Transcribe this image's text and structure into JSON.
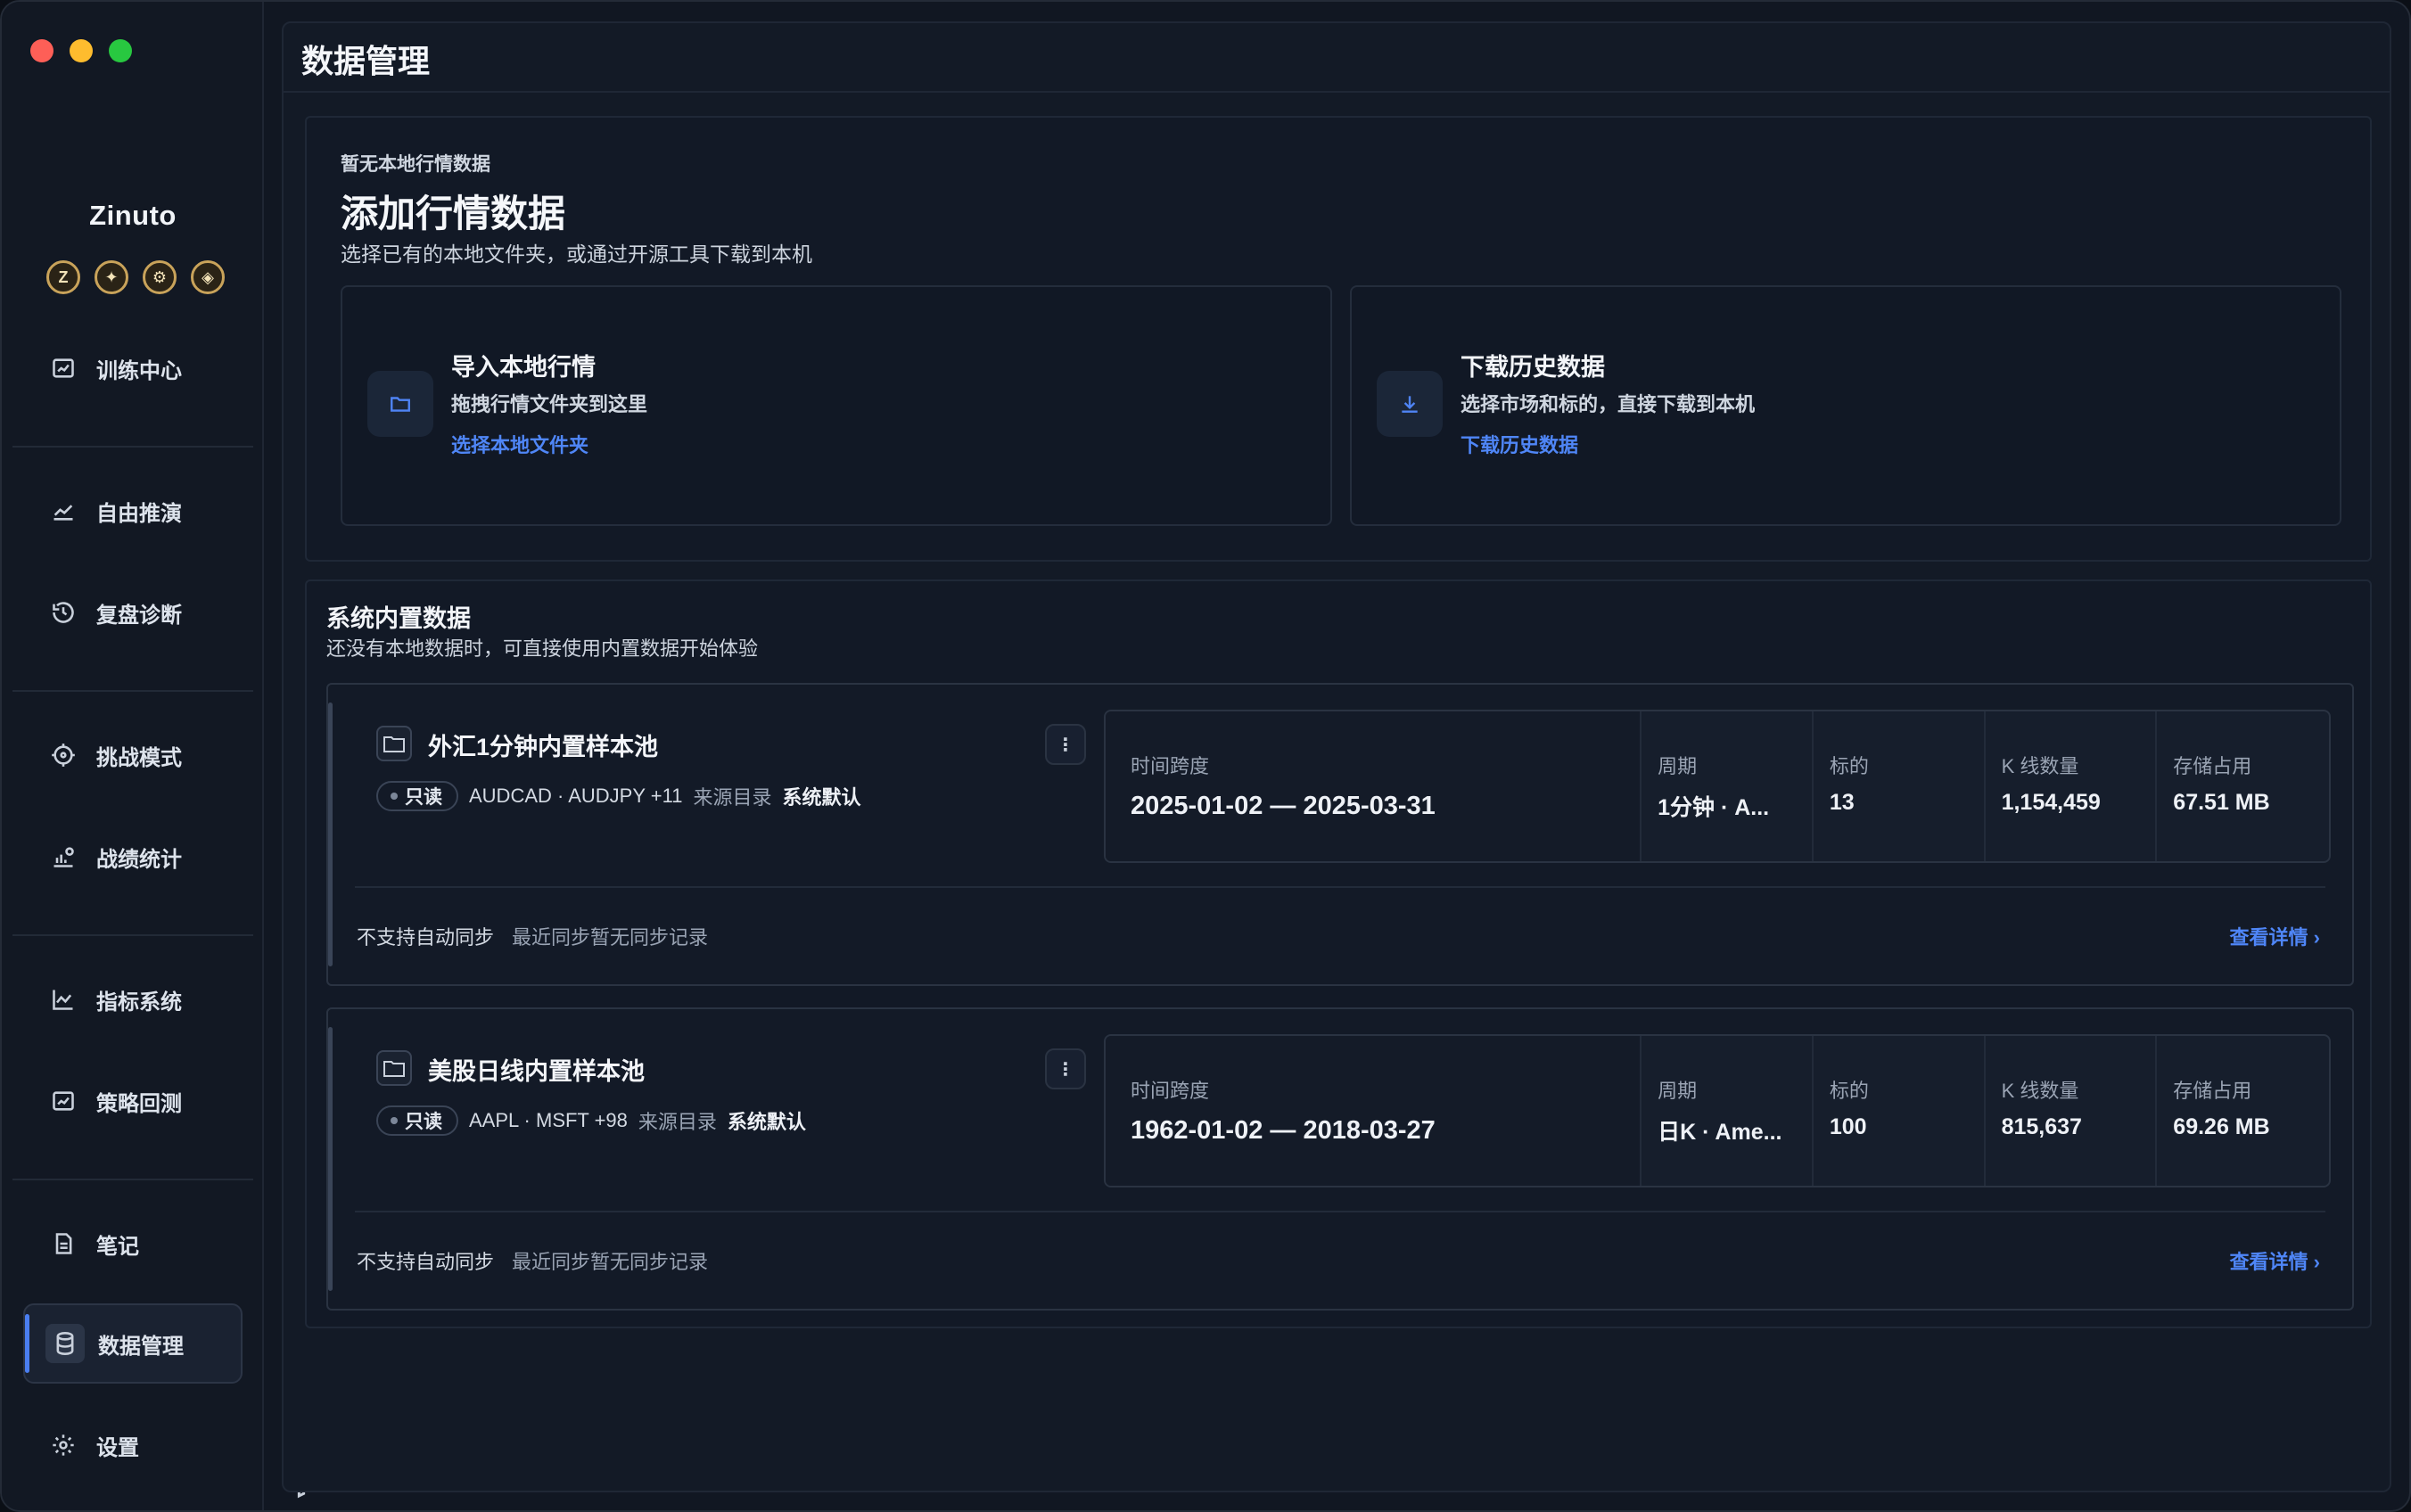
{
  "app": {
    "brand": "Zinuto",
    "coins": [
      "Z",
      "✦",
      "⚙",
      "◈"
    ]
  },
  "sidebar": {
    "items": [
      {
        "label": "训练中心",
        "icon": "image-chart-icon"
      },
      {
        "label": "自由推演",
        "icon": "trend-line-icon"
      },
      {
        "label": "复盘诊断",
        "icon": "history-icon"
      },
      {
        "label": "挑战模式",
        "icon": "target-icon"
      },
      {
        "label": "战绩统计",
        "icon": "bar-user-icon"
      },
      {
        "label": "指标系统",
        "icon": "line-chart-icon"
      },
      {
        "label": "策略回测",
        "icon": "image-chart-icon"
      },
      {
        "label": "笔记",
        "icon": "document-icon"
      },
      {
        "label": "数据管理",
        "icon": "database-icon",
        "active": true
      },
      {
        "label": "设置",
        "icon": "gear-icon"
      }
    ]
  },
  "page": {
    "title": "数据管理"
  },
  "empty": {
    "eyebrow": "暂无本地行情数据",
    "headline": "添加行情数据",
    "subtitle": "选择已有的本地文件夹，或通过开源工具下载到本机",
    "import": {
      "title": "导入本地行情",
      "desc": "拖拽行情文件夹到这里",
      "link": "选择本地文件夹"
    },
    "download": {
      "title": "下载历史数据",
      "desc": "选择市场和标的，直接下载到本机",
      "link": "下载历史数据"
    }
  },
  "builtin": {
    "title": "系统内置数据",
    "subtitle": "还没有本地数据时，可直接使用内置数据开始体验",
    "labels": {
      "readonly": "只读",
      "source": "来源目录",
      "source_value": "系统默认",
      "span": "时间跨度",
      "period": "周期",
      "symbols": "标的",
      "bars": "K 线数量",
      "storage": "存储占用",
      "sync": "不支持自动同步",
      "last_sync": "最近同步暂无同步记录",
      "detail": "查看详情 ›"
    },
    "datasets": [
      {
        "name": "外汇1分钟内置样本池",
        "symbols_text": "AUDCAD · AUDJPY +11",
        "span": "2025-01-02 — 2025-03-31",
        "period": "1分钟 · A...",
        "symbols": "13",
        "bars": "1,154,459",
        "storage": "67.51 MB"
      },
      {
        "name": "美股日线内置样本池",
        "symbols_text": "AAPL · MSFT +98",
        "span": "1962-01-02 — 2018-03-27",
        "period": "日K · Ame...",
        "symbols": "100",
        "bars": "815,637",
        "storage": "69.26 MB"
      }
    ]
  }
}
